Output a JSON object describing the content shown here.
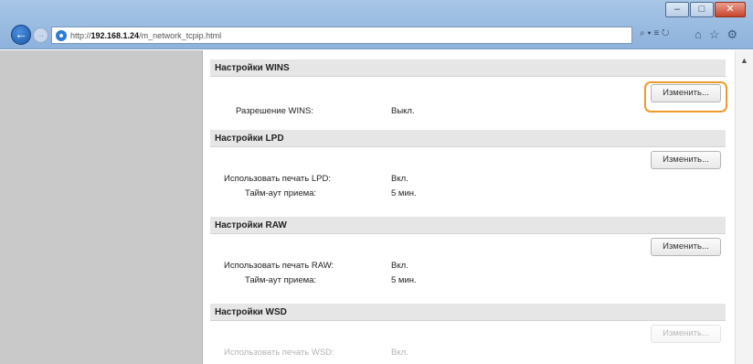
{
  "browser": {
    "url_prefix": "http://",
    "url_host": "192.168.1.24",
    "url_path": "/m_network_tcpip.html",
    "address_tools": "⌕ ▾ ≡ ↻",
    "window_min": "–",
    "window_max": "□",
    "window_close": "✕"
  },
  "sections": [
    {
      "title": "Настройки WINS",
      "button": "Изменить...",
      "rows": [
        {
          "label": "Разрешение WINS:",
          "value": "Выкл."
        }
      ]
    },
    {
      "title": "Настройки LPD",
      "button": "Изменить...",
      "rows": [
        {
          "label": "Использовать печать LPD:",
          "value": "Вкл."
        },
        {
          "label": "Тайм-аут приема:",
          "value": "5 мин."
        }
      ]
    },
    {
      "title": "Настройки RAW",
      "button": "Изменить...",
      "rows": [
        {
          "label": "Использовать печать RAW:",
          "value": "Вкл."
        },
        {
          "label": "Тайм-аут приема:",
          "value": "5 мин."
        }
      ]
    },
    {
      "title": "Настройки WSD",
      "button": "Изменить...",
      "rows": [
        {
          "label": "Использовать печать WSD:",
          "value": "Вкл."
        }
      ]
    }
  ]
}
